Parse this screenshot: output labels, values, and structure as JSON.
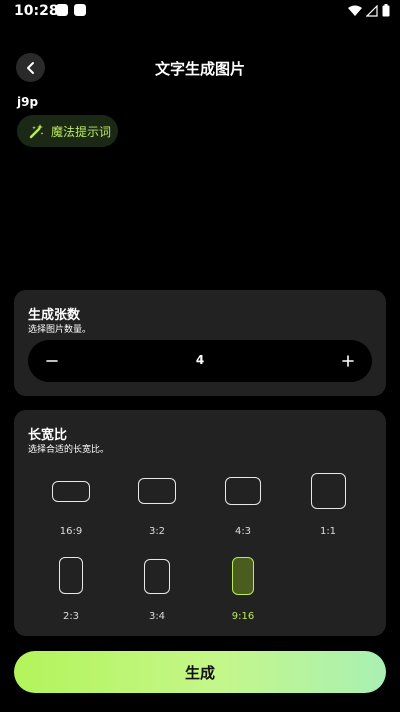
{
  "status": {
    "time": "10:28"
  },
  "header": {
    "title": "文字生成图片"
  },
  "prompt": {
    "text": "j9p",
    "magic_label": "魔法提示词"
  },
  "count_card": {
    "title": "生成张数",
    "subtitle": "选择图片数量。",
    "value": "4"
  },
  "ratio_card": {
    "title": "长宽比",
    "subtitle": "选择合适的长宽比。",
    "options": [
      {
        "label": "16:9"
      },
      {
        "label": "3:2"
      },
      {
        "label": "4:3"
      },
      {
        "label": "1:1"
      },
      {
        "label": "2:3"
      },
      {
        "label": "3:4"
      },
      {
        "label": "9:16",
        "selected": true
      }
    ]
  },
  "generate": {
    "label": "生成"
  },
  "colors": {
    "accent": "#b9ec5a",
    "card": "#222222",
    "background": "#000000"
  }
}
